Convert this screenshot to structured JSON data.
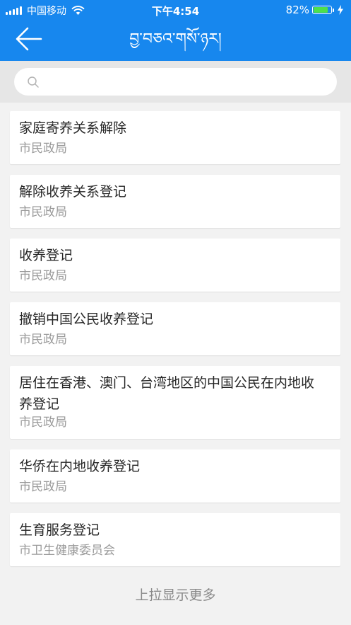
{
  "status_bar": {
    "carrier": "中国移动",
    "time": "下午4:54",
    "battery_percent": "82%",
    "battery_level": 0.82,
    "battery_color": "#4ee04a"
  },
  "nav": {
    "title": "བྱ་བཅའ་གསོ་ཉར།",
    "back_icon": "arrow-left-icon"
  },
  "search": {
    "icon": "search-icon",
    "value": "",
    "placeholder": ""
  },
  "services": [
    {
      "title": "家庭寄养关系解除",
      "department": "市民政局"
    },
    {
      "title": "解除收养关系登记",
      "department": "市民政局"
    },
    {
      "title": "收养登记",
      "department": "市民政局"
    },
    {
      "title": "撤销中国公民收养登记",
      "department": "市民政局"
    },
    {
      "title": "居住在香港、澳门、台湾地区的中国公民在内地收养登记",
      "department": "市民政局"
    },
    {
      "title": "华侨在内地收养登记",
      "department": "市民政局"
    },
    {
      "title": "生育服务登记",
      "department": "市卫生健康委员会"
    }
  ],
  "footer": {
    "load_more": "上拉显示更多"
  },
  "colors": {
    "header": "#1787ee",
    "background": "#f2f2f2",
    "search_area": "#e6e6e6",
    "title_text": "#262626",
    "subtitle_text": "#9a9a9a"
  }
}
